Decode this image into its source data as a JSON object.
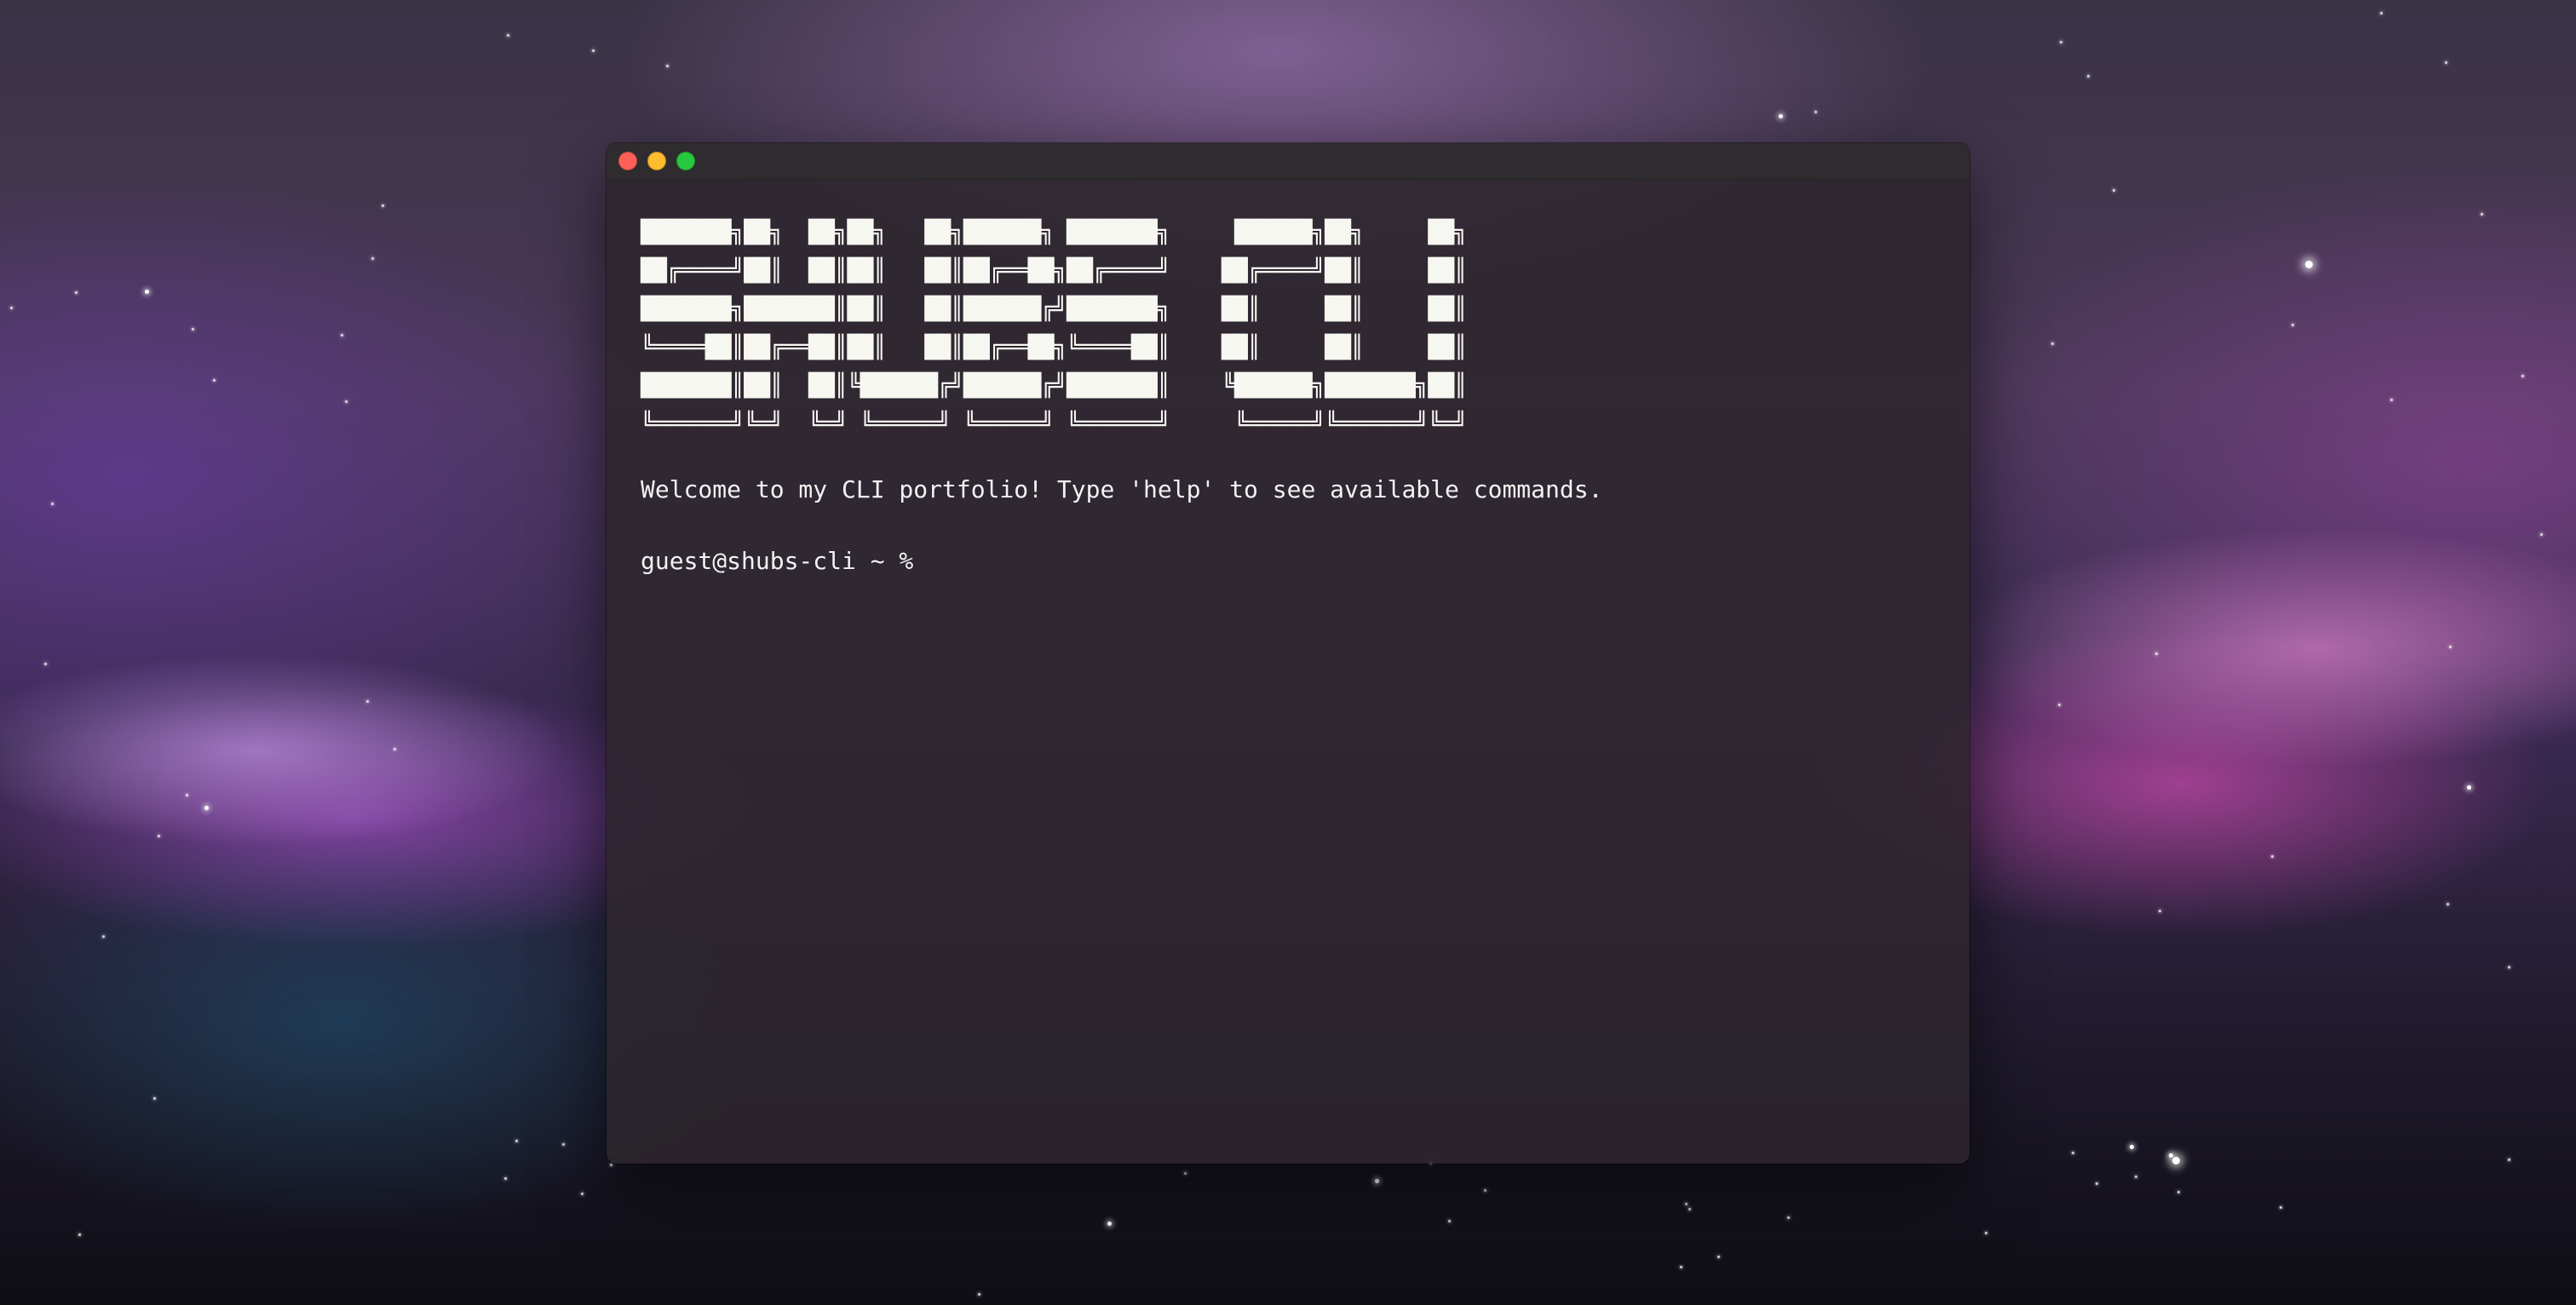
{
  "window": {
    "traffic_lights": [
      {
        "name": "close-button",
        "color": "#ff5f57"
      },
      {
        "name": "minimize-button",
        "color": "#febc2e"
      },
      {
        "name": "zoom-button",
        "color": "#28c840"
      }
    ]
  },
  "terminal": {
    "banner": "███████╗██╗  ██╗██╗   ██╗██████╗ ███████╗     ██████╗██╗     ██╗\n██╔════╝██║  ██║██║   ██║██╔══██╗██╔════╝    ██╔════╝██║     ██║\n███████╗███████║██║   ██║██████╔╝███████╗    ██║     ██║     ██║\n╚════██║██╔══██║██║   ██║██╔══██╗╚════██║    ██║     ██║     ██║\n███████║██║  ██║╚██████╔╝██████╔╝███████║    ╚██████╗███████╗██║\n╚══════╝╚═╝  ╚═╝ ╚═════╝ ╚═════╝ ╚══════╝     ╚═════╝╚══════╝╚═╝",
    "welcome": "Welcome to my CLI portfolio! Type 'help' to see available commands.",
    "prompt": "guest@shubs-cli ~ %",
    "input_value": ""
  }
}
